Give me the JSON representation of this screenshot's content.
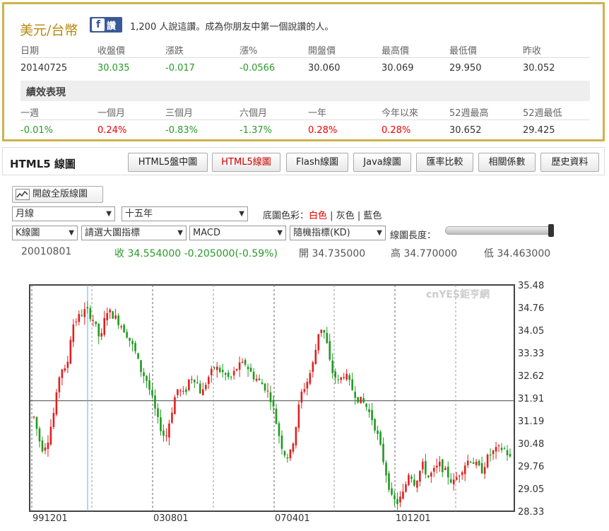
{
  "quote": {
    "title": "美元/台幣",
    "fb_label": "讚",
    "likes_text": "1,200 人說這讚。成為你朋友中第一個說讚的人。",
    "headers": [
      "日期",
      "收盤價",
      "漲跌",
      "漲%",
      "開盤價",
      "最高價",
      "最低價",
      "昨收"
    ],
    "values": [
      "20140725",
      "30.035",
      "-0.017",
      "-0.0566",
      "30.060",
      "30.069",
      "29.950",
      "30.052"
    ],
    "section": "績效表現",
    "perf_headers": [
      "一週",
      "一個月",
      "三個月",
      "六個月",
      "一年",
      "今年以來",
      "52週最高",
      "52週最低"
    ],
    "perf_values": [
      "-0.01%",
      "0.24%",
      "-0.83%",
      "-1.37%",
      "0.28%",
      "0.28%",
      "30.652",
      "29.425"
    ]
  },
  "chart_panel": {
    "title": "HTML5 線圖",
    "tabs": [
      "HTML5盤中圖",
      "HTML5線圖",
      "Flash線圖",
      "Java線圖",
      "匯率比較",
      "相關係數",
      "歷史資料"
    ],
    "active_tab": 1,
    "full_button": "開啟全版線圖",
    "period_select": "月線",
    "range_select": "十五年",
    "bg_label": "底圖色彩：",
    "bg_white": "白色",
    "bg_gray": "灰色",
    "bg_blue": "藍色",
    "chart_type_select": "K線圖",
    "main_indicator_select": "請選大圖指標",
    "macd_select": "MACD",
    "kd_select": "隨機指標(KD)",
    "length_label": "線圖長度：",
    "info_date": "20010801",
    "info_close": "收 34.554000 -0.205000(-0.59%)",
    "info_open": "開 34.735000",
    "info_high": "高 34.770000",
    "info_low": "低 34.463000",
    "watermark": "cnYES鉅亨網"
  },
  "chart_data": {
    "type": "candlestick",
    "ylim": [
      28.33,
      35.48
    ],
    "yticks": [
      "35.48",
      "34.76",
      "34.05",
      "33.33",
      "32.62",
      "31.91",
      "31.19",
      "30.48",
      "29.76",
      "29.05",
      "28.33"
    ],
    "xticks": [
      "991201",
      "030801",
      "070401",
      "101201"
    ],
    "up_color": "#e02020",
    "down_color": "#1f9a1f"
  }
}
